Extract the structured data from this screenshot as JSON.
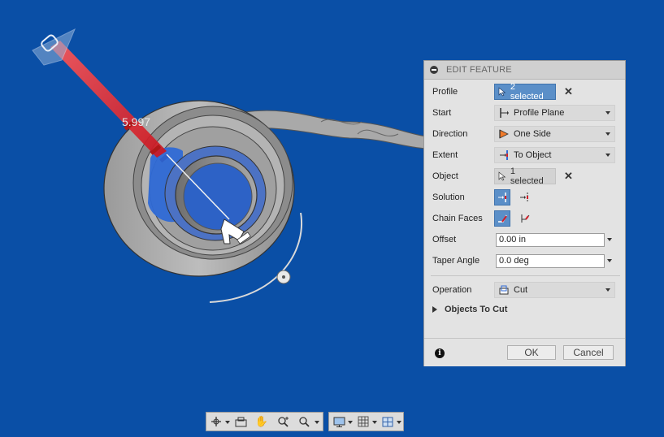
{
  "viewport": {
    "dimension_value": "5.997",
    "background": "#0a4fa6"
  },
  "panel": {
    "title": "EDIT FEATURE",
    "rows": {
      "profile": {
        "label": "Profile",
        "value": "2 selected"
      },
      "start": {
        "label": "Start",
        "value": "Profile Plane"
      },
      "direction": {
        "label": "Direction",
        "value": "One Side"
      },
      "extent": {
        "label": "Extent",
        "value": "To Object"
      },
      "object": {
        "label": "Object",
        "value": "1 selected"
      },
      "solution": {
        "label": "Solution"
      },
      "chain_faces": {
        "label": "Chain Faces"
      },
      "offset": {
        "label": "Offset",
        "value": "0.00 in"
      },
      "taper_angle": {
        "label": "Taper Angle",
        "value": "0.0 deg"
      },
      "operation": {
        "label": "Operation",
        "value": "Cut"
      }
    },
    "objects_to_cut": "Objects To Cut",
    "ok_label": "OK",
    "cancel_label": "Cancel",
    "info_glyph": "i",
    "clear_glyph": "✕"
  },
  "colors": {
    "accent": "#5b8fc8",
    "selection_red": "#e0202a",
    "selection_blue": "#2f6ad6"
  },
  "icons": [
    "orbit-icon",
    "look-at-icon",
    "pan-icon",
    "zoom-icon",
    "zoom-window-icon",
    "display-settings-icon",
    "grid-icon",
    "viewports-icon"
  ]
}
